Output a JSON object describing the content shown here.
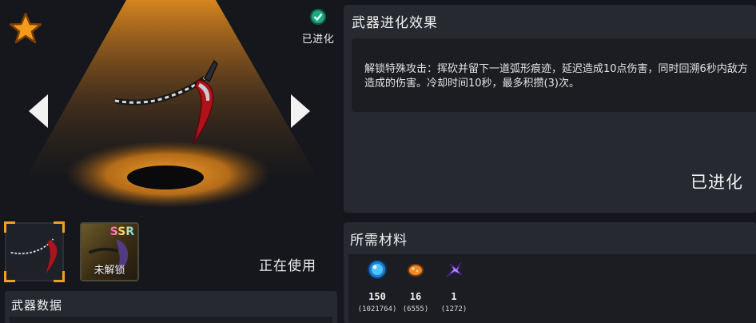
{
  "weapon_view": {
    "evolved_badge": "已进化",
    "favorite_icon": "star-icon",
    "prev_icon": "arrow-left-icon",
    "next_icon": "arrow-right-icon",
    "spotlight_color": "#e08a1e"
  },
  "variants": [
    {
      "name": "scythe-thumbnail",
      "selected": true
    },
    {
      "rarity": "SSR",
      "label": "未解锁"
    }
  ],
  "in_use_label": "正在使用",
  "stats_title": "武器数据",
  "evolution": {
    "title": "武器进化效果",
    "description": "解锁特殊攻击：挥砍并留下一道弧形痕迹，延迟造成10点伤害，同时回溯6秒内敌方造成的伤害。冷却时间10秒，最多积攒(3)次。",
    "status": "已进化"
  },
  "materials": {
    "title": "所需材料",
    "items": [
      {
        "icon": "blue-gem-icon",
        "required": "150",
        "owned": "(1021764)",
        "color": "#4fc3ff"
      },
      {
        "icon": "orange-ore-icon",
        "required": "16",
        "owned": "(6555)",
        "color": "#f08a2a"
      },
      {
        "icon": "purple-shard-icon",
        "required": "1",
        "owned": "(1272)",
        "color": "#b58cff"
      }
    ]
  }
}
